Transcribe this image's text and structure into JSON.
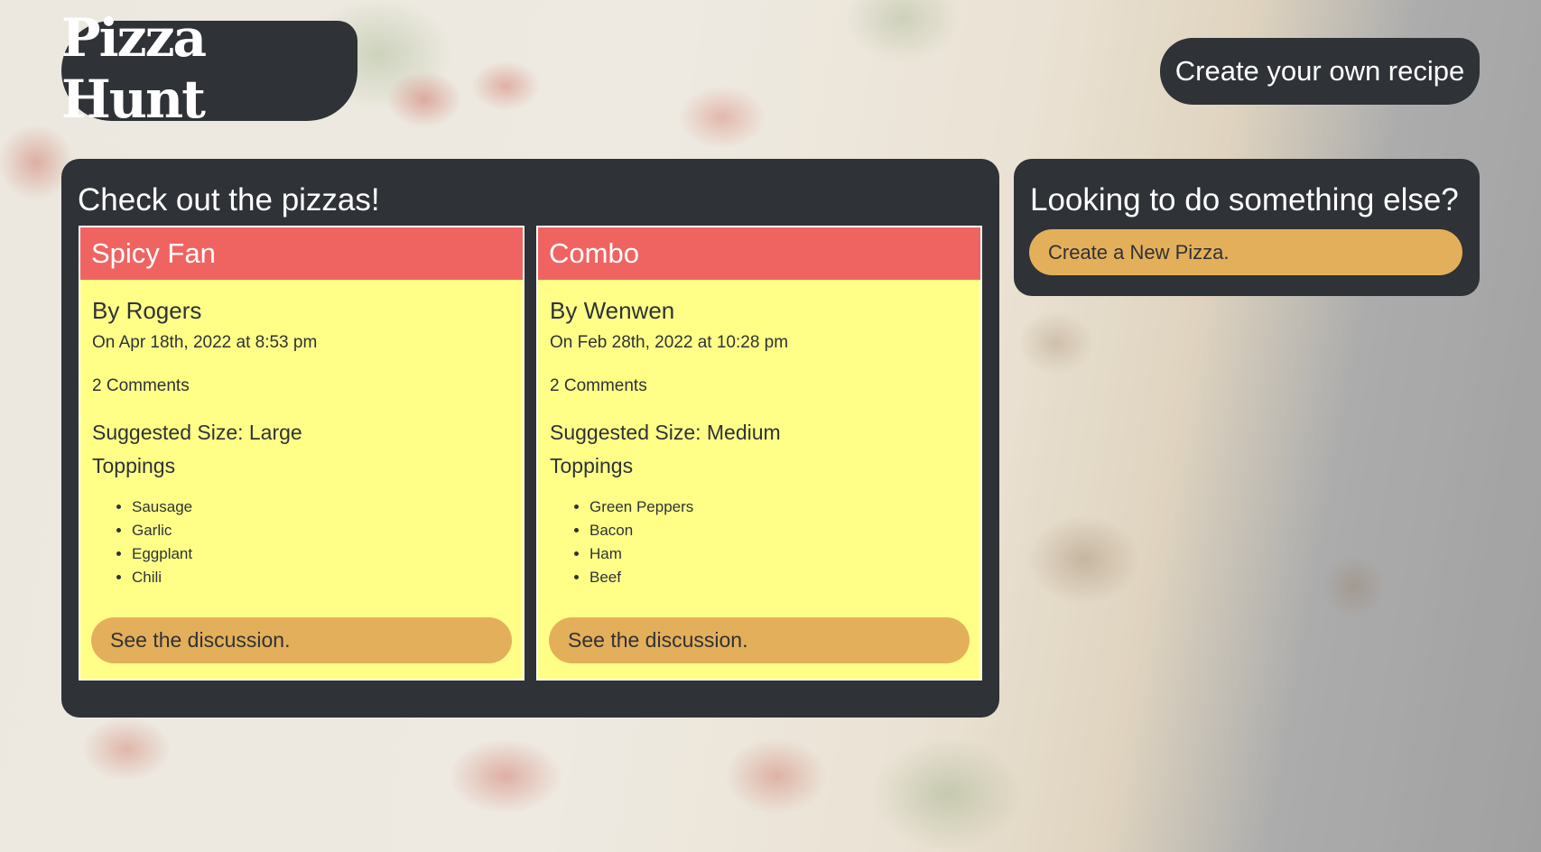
{
  "header": {
    "logo_text": "Pizza Hunt",
    "create_recipe_label": "Create your own recipe"
  },
  "main": {
    "heading": "Check out the pizzas!",
    "pizzas": [
      {
        "name": "Spicy Fan",
        "author": "By Rogers",
        "date": "On Apr 18th, 2022 at 8:53 pm",
        "comments": "2 Comments",
        "size": "Suggested Size: Large",
        "toppings_label": "Toppings",
        "toppings": [
          "Sausage",
          "Garlic",
          "Eggplant",
          "Chili"
        ],
        "discussion_label": "See the discussion."
      },
      {
        "name": "Combo",
        "author": "By Wenwen",
        "date": "On Feb 28th, 2022 at 10:28 pm",
        "comments": "2 Comments",
        "size": "Suggested Size: Medium",
        "toppings_label": "Toppings",
        "toppings": [
          "Green Peppers",
          "Bacon",
          "Ham",
          "Beef"
        ],
        "discussion_label": "See the discussion."
      }
    ]
  },
  "sidebar": {
    "heading": "Looking to do something else?",
    "new_pizza_label": "Create a New Pizza."
  },
  "colors": {
    "panel": "#2f3236",
    "card_header": "#ef6461",
    "card_body": "#ffff88",
    "button": "#e4af5a"
  }
}
